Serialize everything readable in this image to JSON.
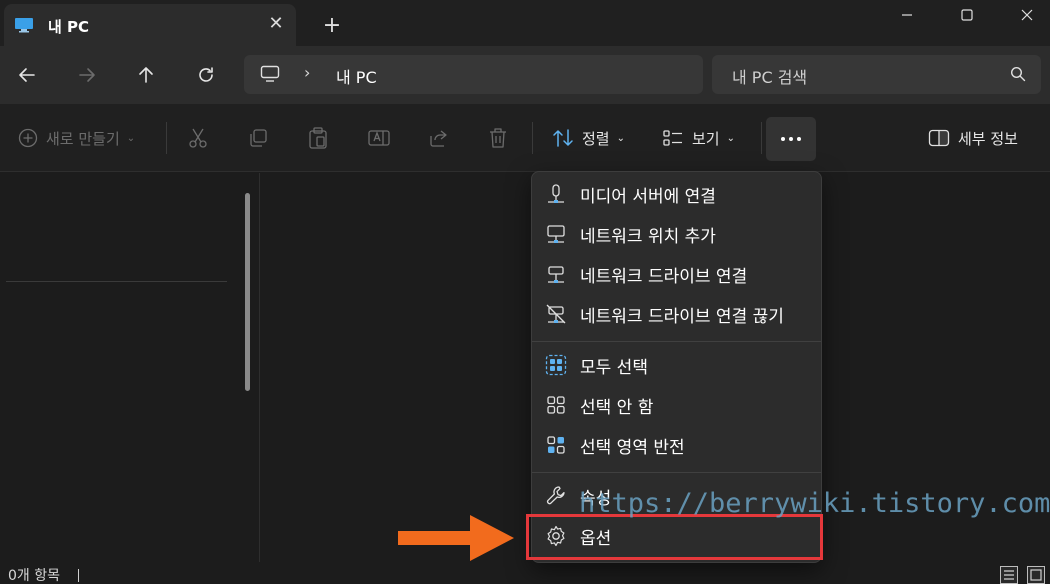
{
  "tab": {
    "title": "내 PC",
    "new_tab": "+"
  },
  "address": {
    "path": "내 PC"
  },
  "search": {
    "placeholder": "내 PC 검색"
  },
  "toolbar": {
    "new_label": "새로 만들기",
    "sort_label": "정렬",
    "view_label": "보기",
    "details_label": "세부 정보"
  },
  "menu": {
    "items": [
      {
        "label": "미디어 서버에 연결",
        "icon": "media-server-icon"
      },
      {
        "label": "네트워크 위치 추가",
        "icon": "network-location-icon"
      },
      {
        "label": "네트워크 드라이브 연결",
        "icon": "network-drive-icon"
      },
      {
        "label": "네트워크 드라이브 연결 끊기",
        "icon": "disconnect-drive-icon"
      },
      {
        "label": "모두 선택",
        "icon": "select-all-icon"
      },
      {
        "label": "선택 안 함",
        "icon": "select-none-icon"
      },
      {
        "label": "선택 영역 반전",
        "icon": "invert-selection-icon"
      },
      {
        "label": "속성",
        "icon": "wrench-icon"
      },
      {
        "label": "옵션",
        "icon": "gear-icon"
      }
    ]
  },
  "status": {
    "items": "0개 항목"
  },
  "watermark": "https://berrywiki.tistory.com",
  "colors": {
    "accent": "#60cdff",
    "highlight": "#e5383b",
    "arrow": "#f26b1d"
  }
}
